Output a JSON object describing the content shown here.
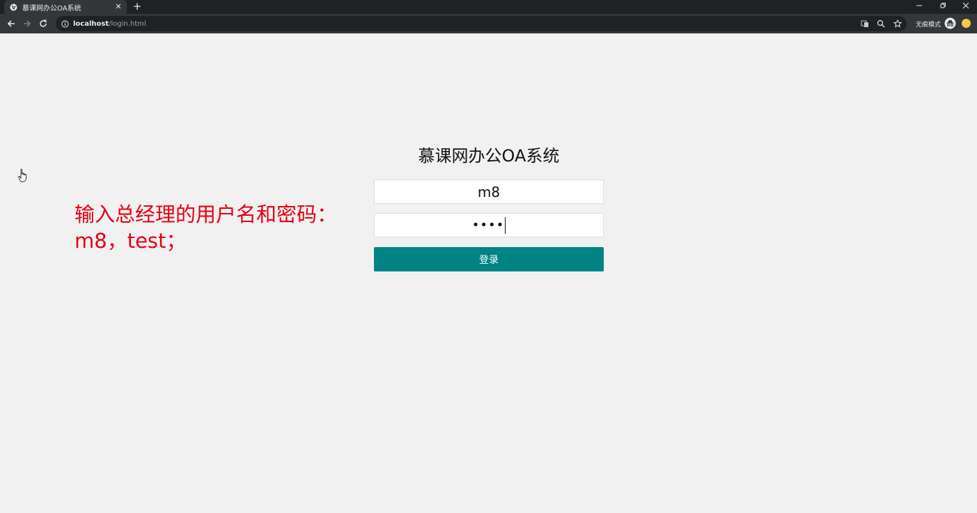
{
  "browser": {
    "tab_title": "慕课网办公OA系统",
    "url_host": "localhost",
    "url_path": "/login.html",
    "incognito_label": "无痕模式"
  },
  "page": {
    "annotation_line1": "输入总经理的用户名和密码：",
    "annotation_line2": "m8，test；",
    "annotation_color": "#e60012",
    "title": "慕课网办公OA系统",
    "username_value": "m8",
    "password_masked": "••••",
    "login_button": "登录",
    "button_color": "#008383"
  }
}
